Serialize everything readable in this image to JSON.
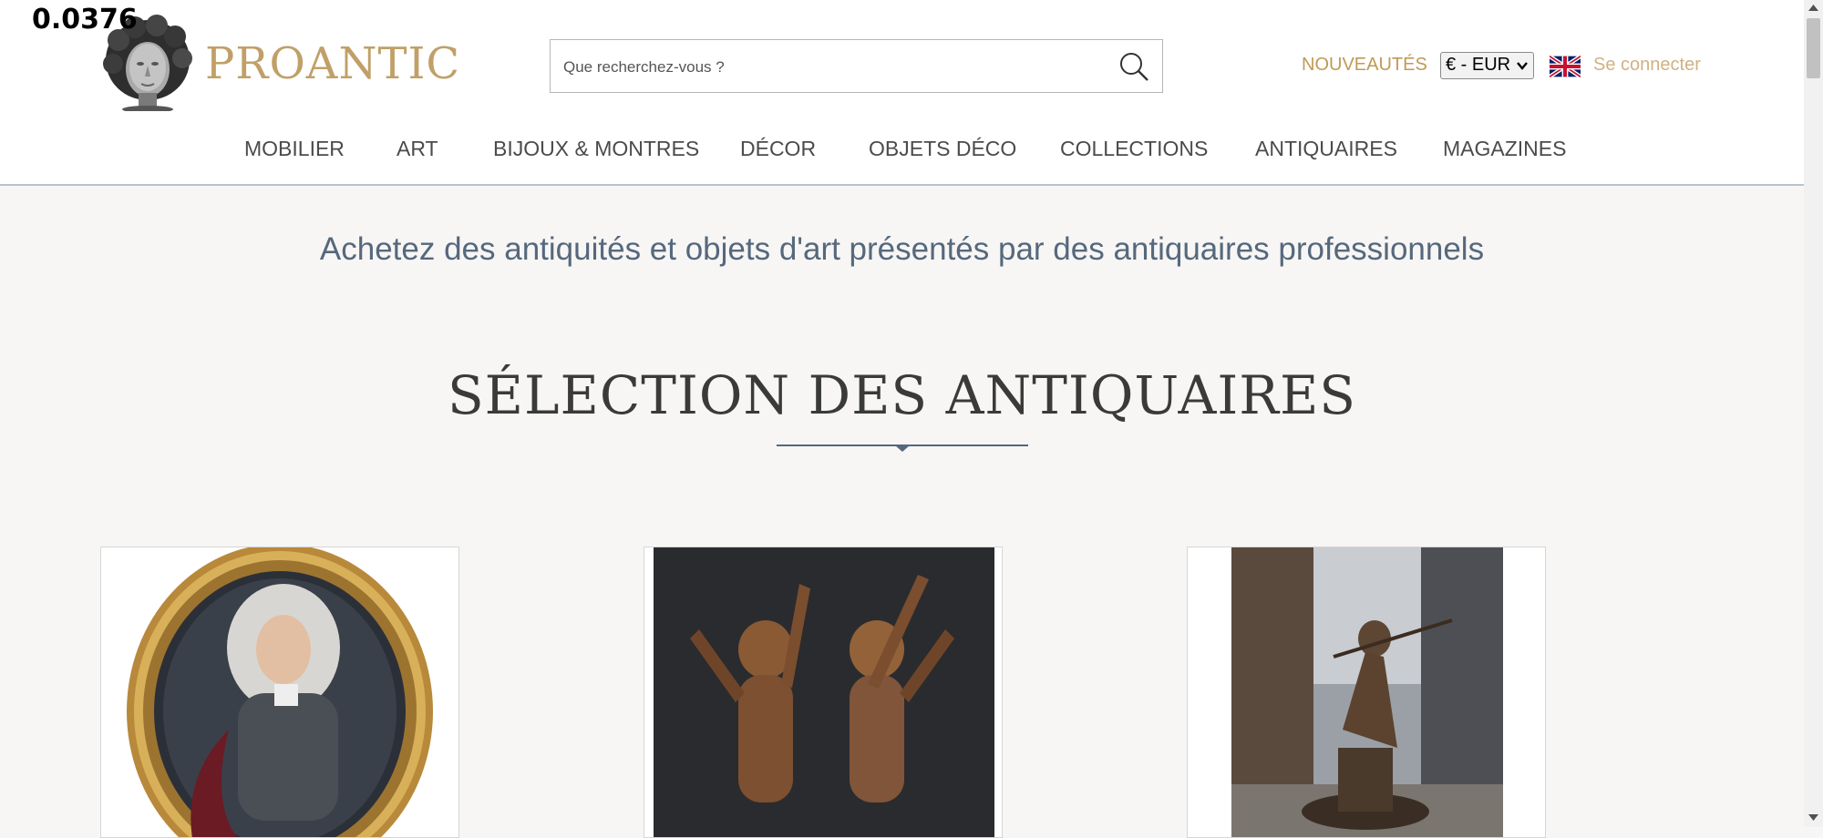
{
  "overlay_number": "0.0376",
  "brand": {
    "name": "PROANTIC",
    "logo_icon": "classical-head-bust-icon"
  },
  "search": {
    "placeholder": "Que recherchez-vous ?",
    "icon": "search-icon"
  },
  "header_links": {
    "nouveautes": "NOUVEAUTÉS",
    "currency": "€ - EUR",
    "language_flag": "uk-flag-icon",
    "login": "Se connecter"
  },
  "nav": {
    "items": [
      {
        "label": "MOBILIER"
      },
      {
        "label": "ART"
      },
      {
        "label": "BIJOUX & MONTRES"
      },
      {
        "label": "DÉCOR"
      },
      {
        "label": "OBJETS DÉCO"
      },
      {
        "label": "COLLECTIONS"
      },
      {
        "label": "ANTIQUAIRES"
      },
      {
        "label": "MAGAZINES"
      }
    ]
  },
  "tagline": "Achetez des antiquités et objets d'art présentés par des antiquaires professionnels",
  "section": {
    "title": "SÉLECTION DES ANTIQUAIRES"
  },
  "cards": [
    {
      "image": "oval-gilt-framed-portrait-painting"
    },
    {
      "image": "pair-of-carved-wooden-cherubs"
    },
    {
      "image": "bronze-statue-seated-figure-in-street"
    }
  ],
  "colors": {
    "brand_gold": "#c0a068",
    "nav_text": "#4b4b4b",
    "tagline_blue": "#56687d",
    "page_bg": "#f7f6f4"
  }
}
